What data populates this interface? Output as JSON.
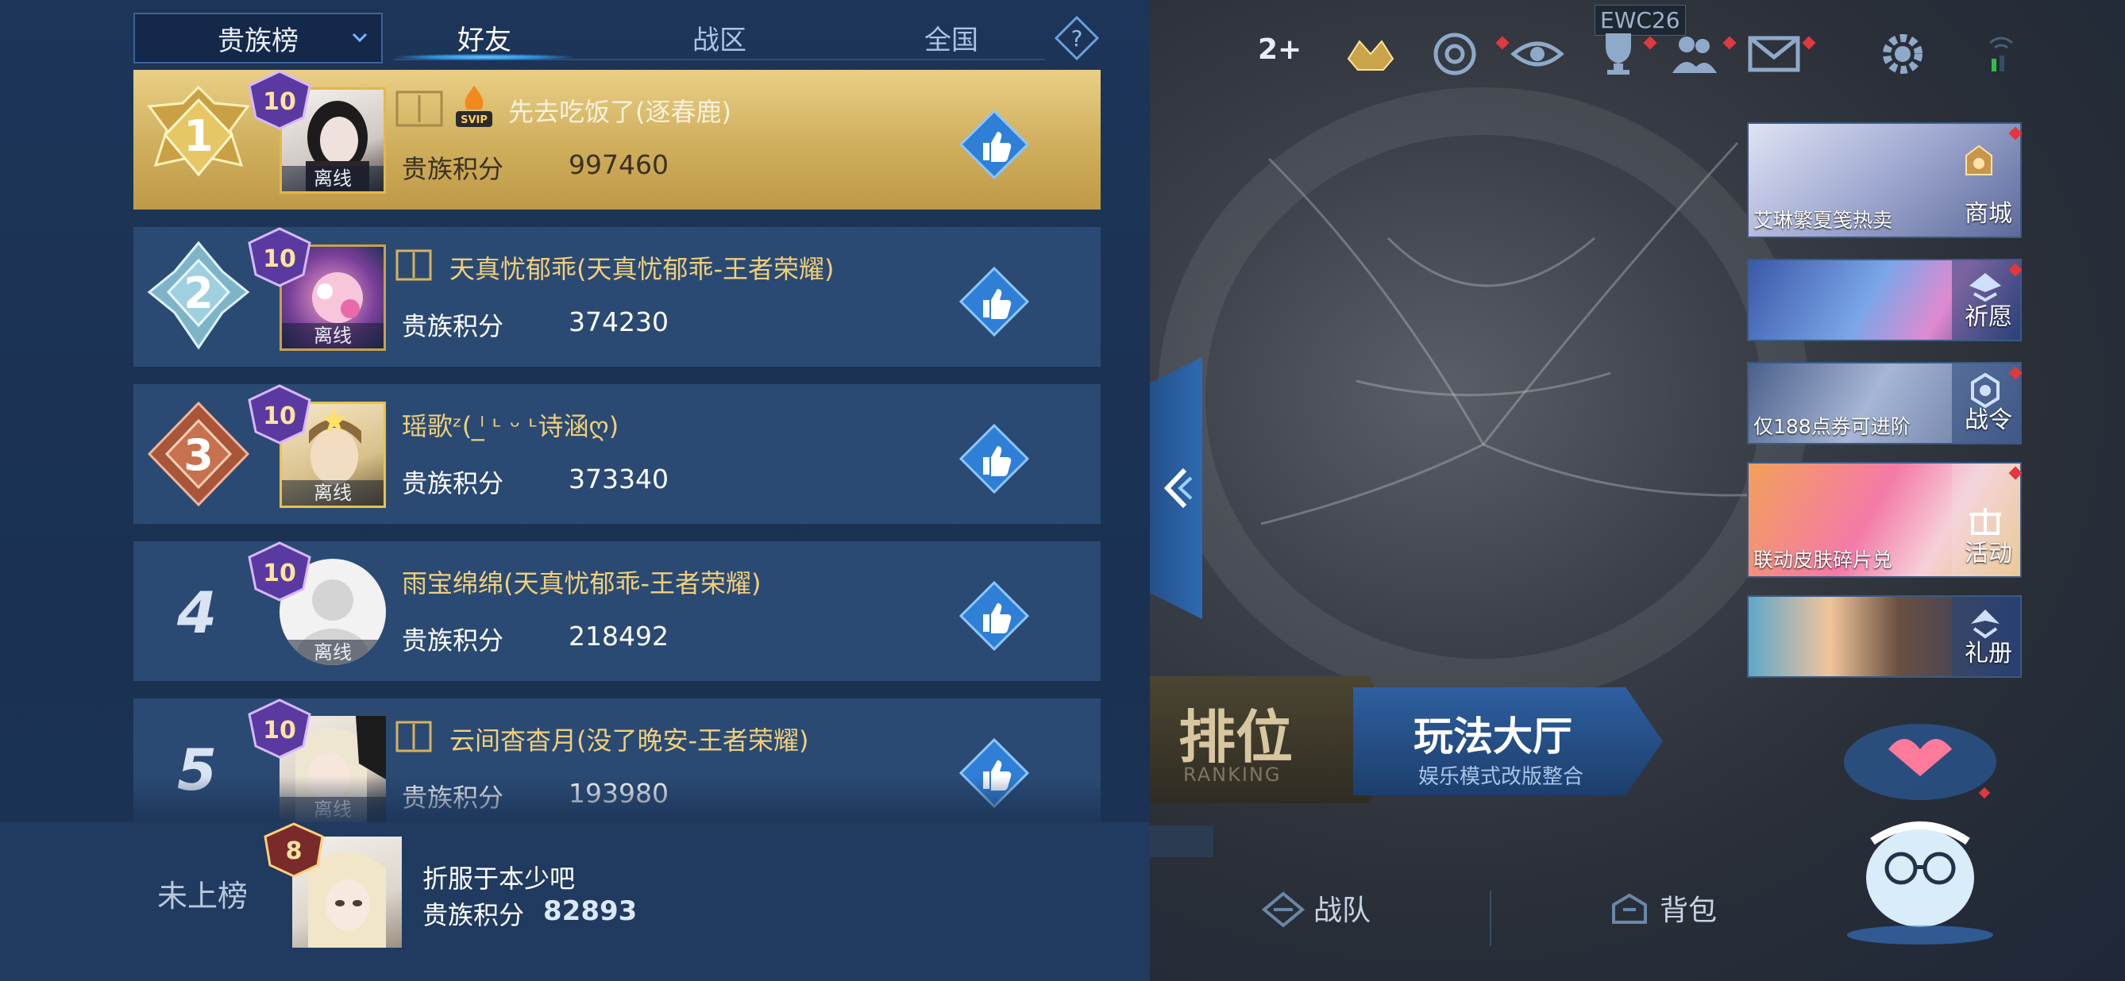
{
  "leaderboard": {
    "selector_label": "贵族榜",
    "tabs": [
      {
        "label": "好友",
        "active": true
      },
      {
        "label": "战区",
        "active": false
      },
      {
        "label": "全国",
        "active": false
      }
    ],
    "score_label": "贵族积分",
    "offline_label": "离线",
    "entries": [
      {
        "rank": "1",
        "vip_level": "10",
        "name": "先去吃饭了(逐春鹿)",
        "score": "997460"
      },
      {
        "rank": "2",
        "vip_level": "10",
        "name": "天真忧郁乖(天真忧郁乖-王者荣耀)",
        "score": "374230"
      },
      {
        "rank": "3",
        "vip_level": "10",
        "name": "瑶歌ᶻ( ˡ̲ ᶫ ᵕ ᶫ诗涵ღ)",
        "score": "373340"
      },
      {
        "rank": "4",
        "vip_level": "10",
        "name": "雨宝绵绵(天真忧郁乖-王者荣耀)",
        "score": "218492"
      },
      {
        "rank": "5",
        "vip_level": "10",
        "name": "云间杳杳月(没了晚安-王者荣耀)",
        "score": "193980"
      }
    ],
    "svip_badge": "SVIP",
    "me": {
      "tag": "未上榜",
      "vip_level": "8",
      "name": "折服于本少吧",
      "score": "82893"
    }
  },
  "game": {
    "ewc_tag": "EWC26",
    "friend_add": "2+",
    "cards": [
      {
        "caption": "艾琳繁夏笺热卖",
        "side_label": "商城"
      },
      {
        "caption": "",
        "side_label": "祈愿"
      },
      {
        "caption": "仅188点券可进阶",
        "side_label": "战令"
      },
      {
        "caption": "联动皮肤碎片兑",
        "side_label": "活动"
      },
      {
        "caption": "",
        "side_label": "礼册"
      }
    ],
    "ranked": {
      "title": "排位",
      "subtitle": "RANKING"
    },
    "hall": {
      "title": "玩法大厅",
      "subtitle": "娱乐模式改版整合"
    },
    "bottom": {
      "team": "战队",
      "bag": "背包"
    }
  },
  "colors": {
    "gold_row": "#d4b468",
    "name_gold": "#f1cf7a",
    "panel": "#2a4a73",
    "accent": "#2f8be0"
  }
}
